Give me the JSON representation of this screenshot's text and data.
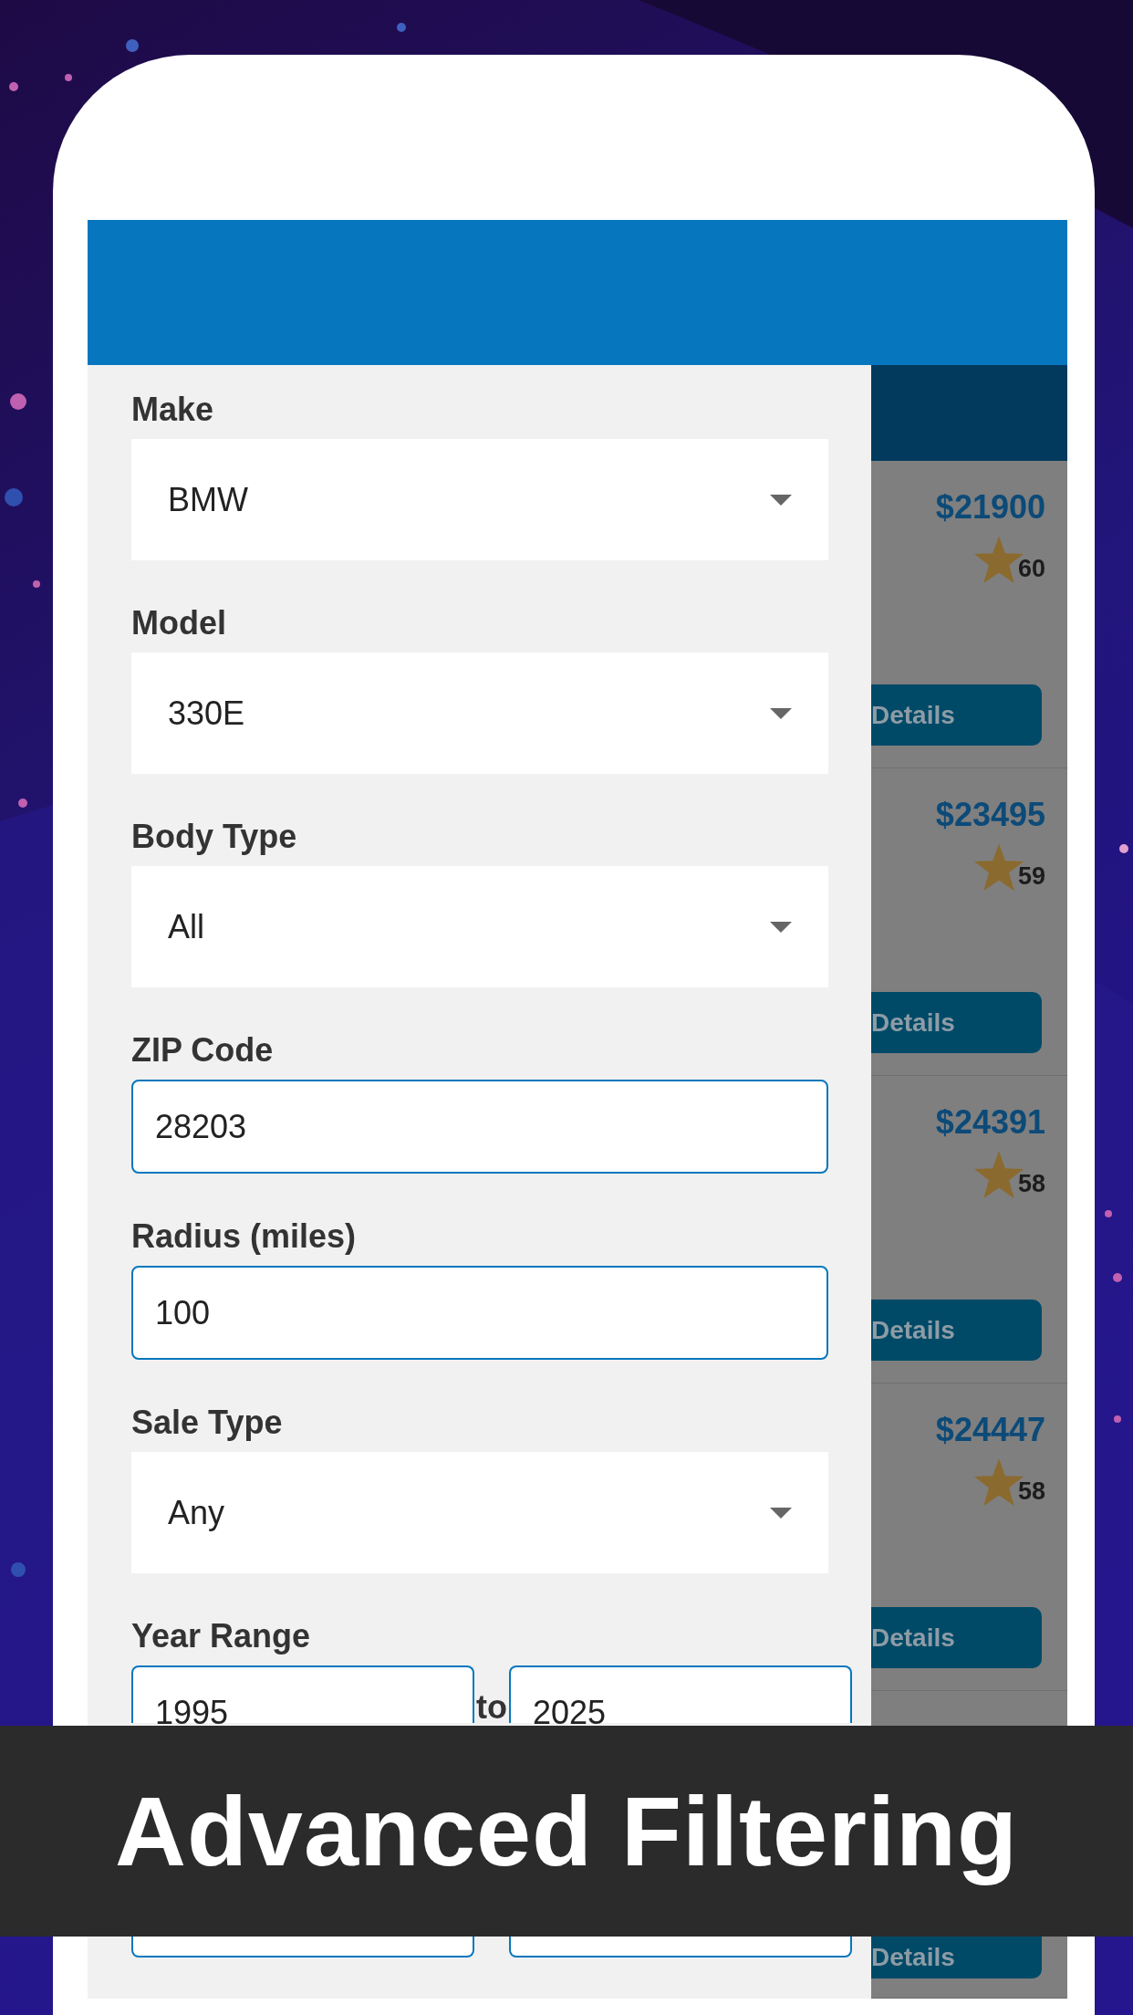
{
  "drawer": {
    "fields": [
      {
        "kind": "select",
        "label": "Make",
        "value": "BMW"
      },
      {
        "kind": "select",
        "label": "Model",
        "value": "330E"
      },
      {
        "kind": "select",
        "label": "Body Type",
        "value": "All"
      },
      {
        "kind": "input",
        "label": "ZIP Code",
        "value": "28203"
      },
      {
        "kind": "input",
        "label": "Radius (miles)",
        "value": "100"
      },
      {
        "kind": "select",
        "label": "Sale Type",
        "value": "Any"
      },
      {
        "kind": "range",
        "label": "Year Range",
        "from": "1995",
        "separator": "to",
        "to": "2025"
      }
    ]
  },
  "listings": [
    {
      "price": "$21900",
      "rating": "60",
      "button": "Details"
    },
    {
      "price": "$23495",
      "rating": "59",
      "button": "Details"
    },
    {
      "price": "$24391",
      "rating": "58",
      "button": "Details"
    },
    {
      "price": "$24447",
      "rating": "58",
      "button": "Details"
    },
    {
      "button": "Details"
    }
  ],
  "banner": {
    "title": "Advanced Filtering"
  }
}
